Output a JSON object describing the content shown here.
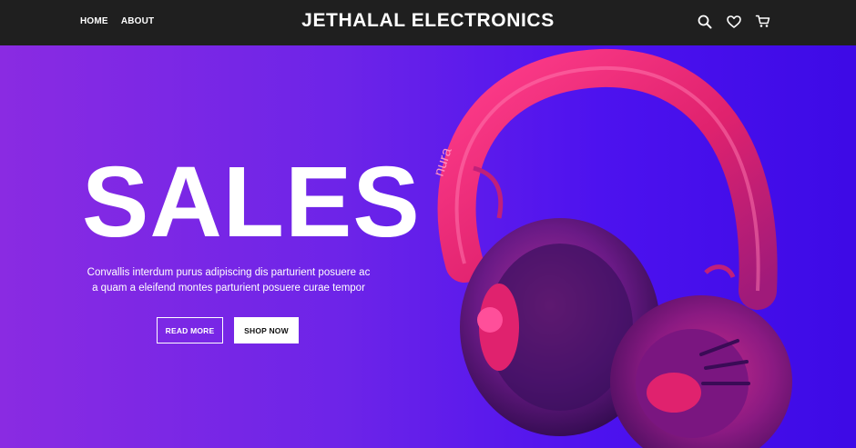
{
  "nav": {
    "links": [
      {
        "label": "HOME"
      },
      {
        "label": "ABOUT"
      }
    ],
    "brand": "JETHALAL ELECTRONICS",
    "icons": [
      "search-icon",
      "heart-icon",
      "cart-icon"
    ]
  },
  "hero": {
    "title": "SALES",
    "description": "Convallis interdum purus adipiscing dis parturient posuere ac a quam a eleifend montes parturient posuere curae tempor",
    "read_more_label": "READ MORE",
    "shop_now_label": "SHOP NOW",
    "product_brand": "nura"
  },
  "colors": {
    "navbar_bg": "#1f1f1f",
    "hero_gradient_start": "#8a2be2",
    "hero_gradient_end": "#3d0ae6",
    "headphone_pink": "#e0226e"
  }
}
